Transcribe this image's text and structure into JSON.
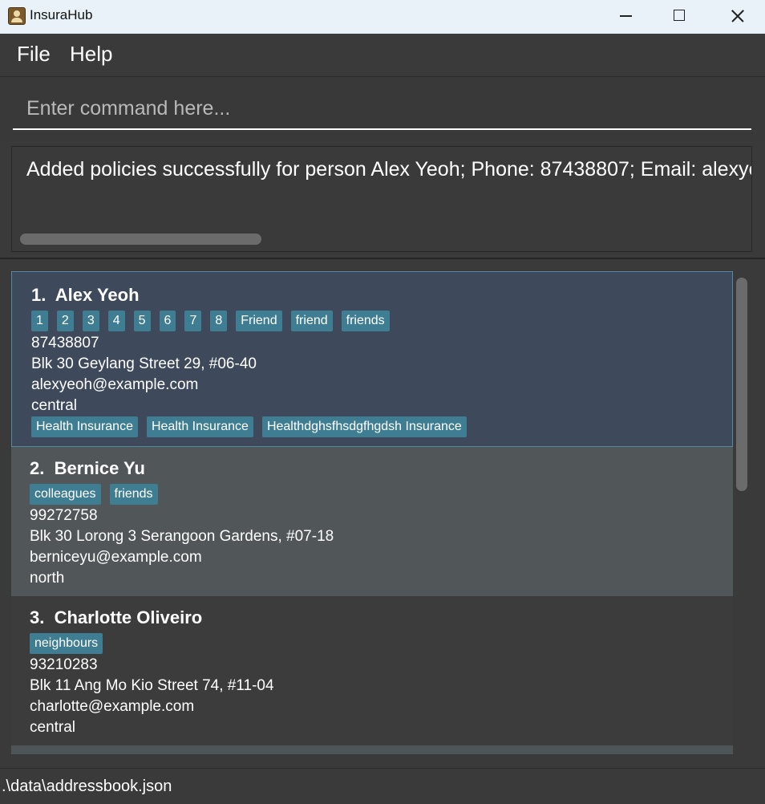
{
  "window": {
    "title": "InsuraHub"
  },
  "menu": {
    "items": [
      "File",
      "Help"
    ]
  },
  "command": {
    "placeholder": "Enter command here..."
  },
  "result": {
    "text": "Added policies successfully for person Alex Yeoh; Phone: 87438807; Email: alexyeoh@example.com"
  },
  "persons": [
    {
      "index": "1.",
      "name": "Alex Yeoh",
      "tags": [
        "1",
        "2",
        "3",
        "4",
        "5",
        "6",
        "7",
        "8",
        "Friend",
        "friend",
        "friends"
      ],
      "phone": "87438807",
      "address": "Blk 30 Geylang Street 29, #06-40",
      "email": "alexyeoh@example.com",
      "region": "central",
      "policies": [
        "Health Insurance",
        "Health Insurance",
        "Healthdghsfhsdgfhgdsh Insurance"
      ]
    },
    {
      "index": "2.",
      "name": "Bernice Yu",
      "tags": [
        "colleagues",
        "friends"
      ],
      "phone": "99272758",
      "address": "Blk 30 Lorong 3 Serangoon Gardens, #07-18",
      "email": "berniceyu@example.com",
      "region": "north"
    },
    {
      "index": "3.",
      "name": "Charlotte Oliveiro",
      "tags": [
        "neighbours"
      ],
      "phone": "93210283",
      "address": "Blk 11 Ang Mo Kio Street 74, #11-04",
      "email": "charlotte@example.com",
      "region": "central"
    }
  ],
  "status": {
    "file_path": ".\\data\\addressbook.json"
  },
  "colors": {
    "tag": "#3f7e92",
    "selected_card": "#3e4a5b",
    "selected_border": "#4f8ca1",
    "background": "#3a3a3a"
  }
}
